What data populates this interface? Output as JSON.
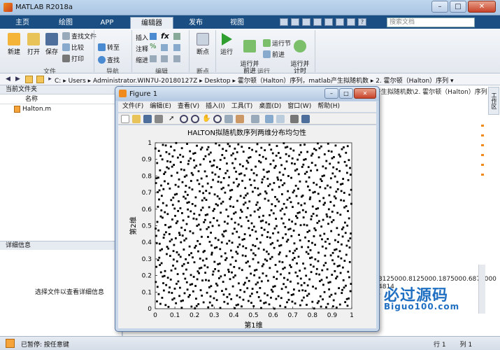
{
  "window": {
    "title": "MATLAB R2018a"
  },
  "tabs": [
    "主页",
    "绘图",
    "APP",
    "编辑器",
    "发布",
    "视图"
  ],
  "search": {
    "placeholder": "搜索文档"
  },
  "ribbon": {
    "file": {
      "new": "新建",
      "open": "打开",
      "save": "保存",
      "find_files": "查找文件",
      "compare": "比较",
      "print": "打印",
      "label": "文件"
    },
    "navigate": {
      "goto": "转至",
      "find": "查找",
      "label": "导航"
    },
    "edit": {
      "insert": "插入",
      "comment": "注释",
      "indent": "缩进",
      "label": "编辑"
    },
    "breakpoints": {
      "breakpoints": "断点",
      "label": "断点"
    },
    "run": {
      "run": "运行",
      "run_advance": "运行并\n前进",
      "run_section": "运行节",
      "advance": "前进",
      "run_time": "运行并\n计时",
      "label": "运行"
    }
  },
  "address": {
    "segments": [
      "C:",
      "Users",
      "Administrator.WIN7U-20180127Z",
      "Desktop",
      "霍尔顿（Halton）序列，matlab产生拟随机数",
      "2. 霍尔顿（Halton）序列"
    ]
  },
  "left_panel": {
    "title": "当前文件夹",
    "column_name": "名称",
    "files": [
      "Halton.m"
    ],
    "details_title": "详细信息",
    "details_hint": "选择文件以查看详细信息"
  },
  "right_panel": {
    "header": "n产生拟随机数\\2. 霍尔顿（Halton）序列",
    "command_output": [
      "3125000.8125000.1875000.6875000",
      "4814"
    ]
  },
  "status": {
    "text": "已暂停: 按任意键",
    "row_label": "行",
    "row_value": "1",
    "col_label": "列",
    "col_value": "1"
  },
  "watermark": {
    "text": "必过源码",
    "url": "Biguo100.com"
  },
  "figure": {
    "title": "Figure 1",
    "menu": [
      "文件(F)",
      "编辑(E)",
      "查看(V)",
      "插入(I)",
      "工具(T)",
      "桌面(D)",
      "窗口(W)",
      "帮助(H)"
    ]
  },
  "chart_data": {
    "type": "scatter",
    "title": "HALTON拟随机数序列两维分布均匀性",
    "xlabel": "第1维",
    "ylabel": "第2维",
    "xlim": [
      0,
      1
    ],
    "ylim": [
      0,
      1
    ],
    "xticks": [
      0,
      0.1,
      0.2,
      0.3,
      0.4,
      0.5,
      0.6,
      0.7,
      0.8,
      0.9,
      1
    ],
    "yticks": [
      0,
      0.1,
      0.2,
      0.3,
      0.4,
      0.5,
      0.6,
      0.7,
      0.8,
      0.9,
      1
    ],
    "grid": false,
    "legend": "none",
    "marker_color": "#000000",
    "series": [
      {
        "sequence": "halton",
        "bases": [
          2,
          3
        ],
        "n_points": 1000
      }
    ]
  }
}
